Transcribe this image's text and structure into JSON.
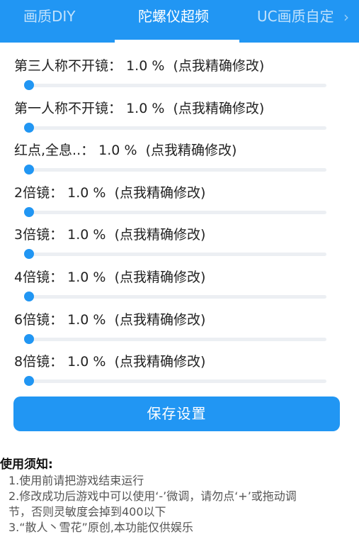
{
  "tabs": [
    {
      "label": "画质DIY",
      "active": false
    },
    {
      "label": "陀螺仪超频",
      "active": true
    },
    {
      "label": "UC画质自定",
      "active": false
    }
  ],
  "colors": {
    "accent": "#2196f3",
    "track": "#eceff3",
    "text": "#222222",
    "note_text": "#555555"
  },
  "settings": [
    {
      "name": "第三人称不开镜：",
      "value": "1.0",
      "unit": "%",
      "hint": "(点我精确修改)",
      "level_percent": 1.0
    },
    {
      "name": "第一人称不开镜：",
      "value": "1.0",
      "unit": "%",
      "hint": "(点我精确修改)",
      "level_percent": 1.0
    },
    {
      "name": "红点,全息..：",
      "value": "1.0",
      "unit": "%",
      "hint": "(点我精确修改)",
      "level_percent": 1.0
    },
    {
      "name": "2倍镜：",
      "value": "1.0",
      "unit": "%",
      "hint": "(点我精确修改)",
      "level_percent": 1.0
    },
    {
      "name": "3倍镜：",
      "value": "1.0",
      "unit": "%",
      "hint": "(点我精确修改)",
      "level_percent": 1.0
    },
    {
      "name": "4倍镜：",
      "value": "1.0",
      "unit": "%",
      "hint": "(点我精确修改)",
      "level_percent": 1.0
    },
    {
      "name": "6倍镜：",
      "value": "1.0",
      "unit": "%",
      "hint": "(点我精确修改)",
      "level_percent": 1.0
    },
    {
      "name": "8倍镜：",
      "value": "1.0",
      "unit": "%",
      "hint": "(点我精确修改)",
      "level_percent": 1.0
    }
  ],
  "save_label": "保存设置",
  "notes": {
    "title": "使用须知:",
    "lines": [
      "1.使用前请把游戏结束运行",
      "2.修改成功后游戏中可以使用‘-’微调，请勿点‘+’或拖动调",
      "节，否则灵敏度会掉到400以下",
      "3.“散人丶雪花”原创,本功能仅供娱乐"
    ]
  }
}
